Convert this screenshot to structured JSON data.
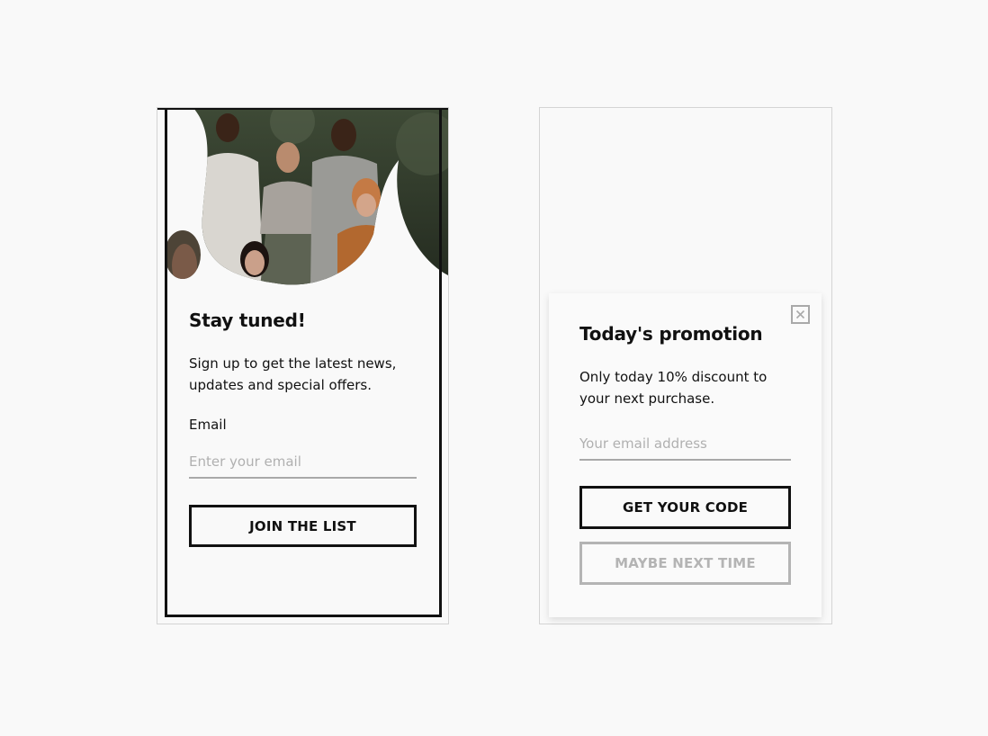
{
  "signup_card": {
    "title": "Stay tuned!",
    "description": "Sign up to get the latest news, updates and special offers.",
    "email_label": "Email",
    "email_placeholder": "Enter your email",
    "button_label": "JOIN THE LIST"
  },
  "promo_card": {
    "title": "Today's promotion",
    "description": "Only today 10% discount to your next purchase.",
    "email_placeholder": "Your email address",
    "primary_button": "GET YOUR CODE",
    "secondary_button": "MAYBE NEXT TIME",
    "close_icon": "close-icon"
  },
  "colors": {
    "background": "#f9f9f9",
    "text": "#111111",
    "muted": "#b4b4b4",
    "border": "#d4d4d4"
  }
}
